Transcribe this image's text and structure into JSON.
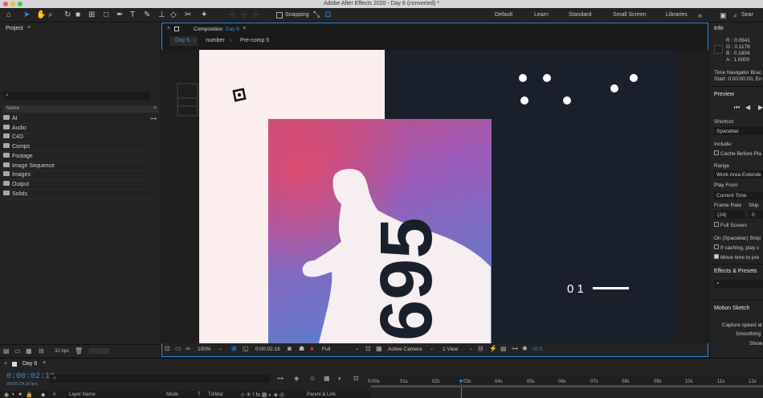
{
  "window": {
    "title": "Adobe After Effects 2020 - Day 6 (converted) *"
  },
  "toolbar": {
    "snapping_label": "Snapping",
    "workspaces": [
      "Default",
      "Learn",
      "Standard",
      "Small Screen",
      "Libraries"
    ],
    "search_label": "Sear"
  },
  "project": {
    "tab": "Project",
    "column_name": "Name",
    "folders": [
      "AI",
      "Audio",
      "C4D",
      "Comps",
      "Footage",
      "Image Sequence",
      "Images",
      "Output",
      "Solids"
    ],
    "bpc": "32 bpc"
  },
  "composition": {
    "panel_label": "Composition",
    "active_comp": "Day 6",
    "breadcrumbs": [
      "Day 6",
      "number",
      "Pre-comp 5"
    ],
    "zoom": "100%",
    "timecode": "0:00:02:18",
    "resolution": "Full",
    "camera": "Active Camera",
    "views": "1 View",
    "exposure": "+0.0",
    "artwork": {
      "big_text": "695",
      "counter": "0 1"
    }
  },
  "info": {
    "tab": "Info",
    "r": "R :  0.0941",
    "g": "G :  0.1176",
    "b": "B :  0.1804",
    "a": "A :  1.0000",
    "nav1": "Time Navigator Brac",
    "nav2": "Start: 0:00:00:00, En"
  },
  "preview": {
    "tab": "Preview",
    "shortcut_label": "Shortcut",
    "shortcut_value": "Spacebar",
    "include_label": "Include:",
    "cache_label": "Cache Before Pla",
    "range_label": "Range",
    "range_value": "Work Area Extende",
    "play_from_label": "Play From",
    "play_from_value": "Current Time",
    "frame_rate_label": "Frame Rate",
    "skip_label": "Skip",
    "frame_rate_value": "(24)",
    "skip_value": "0",
    "full_screen_label": "Full Screen",
    "on_stop_label": "On (Spacebar) Stop:",
    "if_caching_label": "If caching, play c",
    "move_time_label": "Move time to pre"
  },
  "effects": {
    "tab": "Effects & Presets"
  },
  "motion_sketch": {
    "tab": "Motion Sketch",
    "line1": "Capture speed at",
    "line2": "Smoothing",
    "line3": "Show"
  },
  "timeline": {
    "tab": "Day 6",
    "timecode": "0:00:02:18",
    "frames": "00066 (24.00 fps)",
    "ruler": [
      "0:00s",
      "01s",
      "02s",
      "03s",
      "04s",
      "05s",
      "06s",
      "07s",
      "08s",
      "09s",
      "10s",
      "11s",
      "12s"
    ],
    "col_layer_name": "Layer Name",
    "col_mode": "Mode",
    "col_t": "T",
    "col_trkmat": "TrkMat",
    "col_parent": "Parent & Link"
  },
  "colors": {
    "accent": "#2d8ceb",
    "canvas_light": "#fbeeed",
    "canvas_dark": "#19202c",
    "gradient_top": "#b14e98",
    "gradient_bottom": "#6a78c2"
  }
}
